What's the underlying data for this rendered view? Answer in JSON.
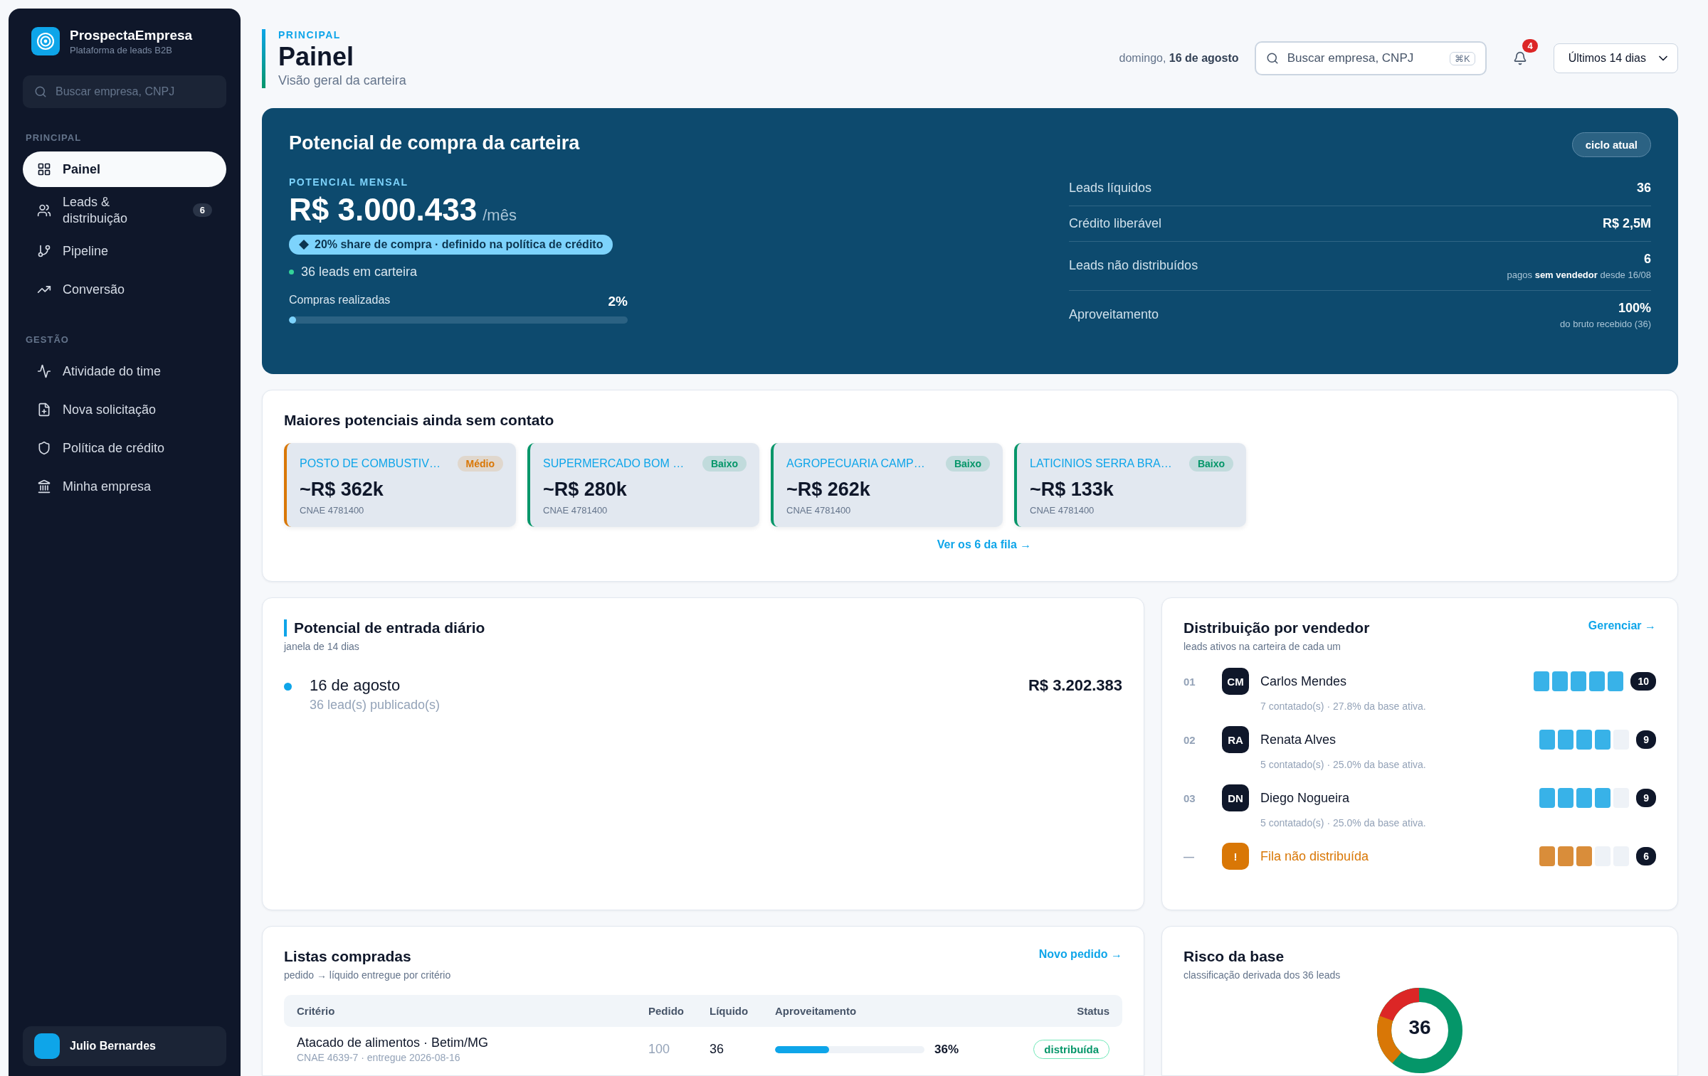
{
  "sidebar": {
    "brand": {
      "name": "ProspectaEmpresa",
      "tagline": "Plataforma de leads B2B"
    },
    "search": {
      "placeholder": "Buscar empresa, CNPJ"
    },
    "sections": [
      {
        "title": "PRINCIPAL",
        "items": [
          {
            "label": "Painel",
            "selected": true
          },
          {
            "label": "Leads &\ndistribuição",
            "selected": false,
            "badge": "6"
          },
          {
            "label": "Pipeline",
            "selected": false
          },
          {
            "label": "Conversão",
            "selected": false
          }
        ]
      },
      {
        "title": "GESTÃO",
        "items": [
          {
            "label": "Atividade do time",
            "selected": false
          },
          {
            "label": "Nova solicitação",
            "selected": false
          },
          {
            "label": "Política de crédito",
            "selected": false
          },
          {
            "label": "Minha empresa",
            "selected": false
          }
        ]
      }
    ],
    "user": {
      "name": "Julio Bernardes"
    }
  },
  "header": {
    "eyebrow": "PRINCIPAL",
    "title": "Painel",
    "subtitle": "Visão geral da carteira",
    "date": "domingo, **16 de agosto**",
    "search": {
      "placeholder": "Buscar empresa, CNPJ",
      "shortcut": "⌘K"
    },
    "notifications": "4",
    "period": "Últimos 14 dias"
  },
  "hero": {
    "title": "Potencial de compra da carteira",
    "pill": "ciclo atual",
    "label": "POTENCIAL MENSAL",
    "value": "R$ 3.000.433",
    "unit": "/mês",
    "badge": "20% share de compra · definido na política de crédito",
    "leads": "36 leads em carteira",
    "progress": {
      "label": "Compras realizadas",
      "reading": "2%",
      "level": 0.02
    },
    "stats": [
      {
        "label": "Leads líquidos",
        "value": "36"
      },
      {
        "label": "Crédito liberável",
        "value": "R$ 2,5M"
      },
      {
        "label": "Leads não distribuídos",
        "value": "6",
        "note": "pagos **sem vendedor** desde 16/08"
      },
      {
        "label": "Aproveitamento",
        "value": "100%",
        "note": "do bruto recebido (36)"
      }
    ]
  },
  "top_potentials": {
    "title": "Maiores potenciais ainda sem contato",
    "link": "Ver os 6 da fila →",
    "cards": [
      {
        "name": "POSTO DE COMBUSTIV…",
        "tier": "Médio",
        "color": "#d97706",
        "value": "~R$ 362k",
        "cnae": "CNAE 4781400"
      },
      {
        "name": "SUPERMERCADO BOM …",
        "tier": "Baixo",
        "color": "#059669",
        "value": "~R$ 280k",
        "cnae": "CNAE 4781400"
      },
      {
        "name": "AGROPECUARIA CAMP…",
        "tier": "Baixo",
        "color": "#059669",
        "value": "~R$ 262k",
        "cnae": "CNAE 4781400"
      },
      {
        "name": "LATICINIOS SERRA BRA…",
        "tier": "Baixo",
        "color": "#059669",
        "value": "~R$ 133k",
        "cnae": "CNAE 4781400"
      }
    ]
  },
  "daily_entry": {
    "title": "Potencial de entrada diário",
    "subtitle": "janela de 14 dias",
    "entries": [
      {
        "date": "16 de agosto",
        "detail": "36 lead(s) publicado(s)",
        "value": "R$ 3.202.383"
      }
    ]
  },
  "distribution": {
    "title": "Distribuição por vendedor",
    "subtitle": "leads ativos na carteira de cada um",
    "link": "Gerenciar →",
    "rows": [
      {
        "kind": "seller",
        "rank": "01",
        "initials": "CM",
        "name": "Carlos Mendes",
        "note": "7 contatado(s) · 27.8% da base ativa.",
        "stars": 5,
        "count": "10"
      },
      {
        "kind": "seller",
        "rank": "02",
        "initials": "RA",
        "name": "Renata Alves",
        "note": "5 contatado(s) · 25.0% da base ativa.",
        "stars": 4,
        "count": "9"
      },
      {
        "kind": "seller",
        "rank": "03",
        "initials": "DN",
        "name": "Diego Nogueira",
        "note": "5 contatado(s) · 25.0% da base ativa.",
        "stars": 4,
        "count": "9"
      },
      {
        "kind": "queue",
        "rank": "—",
        "initials": "!",
        "name": "Fila não distribuída",
        "stars": 3,
        "count": "6"
      }
    ]
  },
  "purchased_lists": {
    "title": "Listas compradas",
    "subtitle": "pedido → líquido entregue por critério",
    "link": "Novo pedido →",
    "columns": [
      "Critério",
      "Pedido",
      "Líquido",
      "Aproveitamento",
      "Status"
    ],
    "rows": [
      {
        "criterion": "Atacado de alimentos · Betim/MG",
        "detail": "CNAE 4639-7 · entregue 2026-08-16",
        "ordered": "100",
        "net": "36",
        "level": 0.36,
        "reading": "36%",
        "status": "distribuída"
      }
    ]
  },
  "risk": {
    "title": "Risco da base",
    "subtitle": "classificação derivada dos 36 leads",
    "center": "36"
  }
}
